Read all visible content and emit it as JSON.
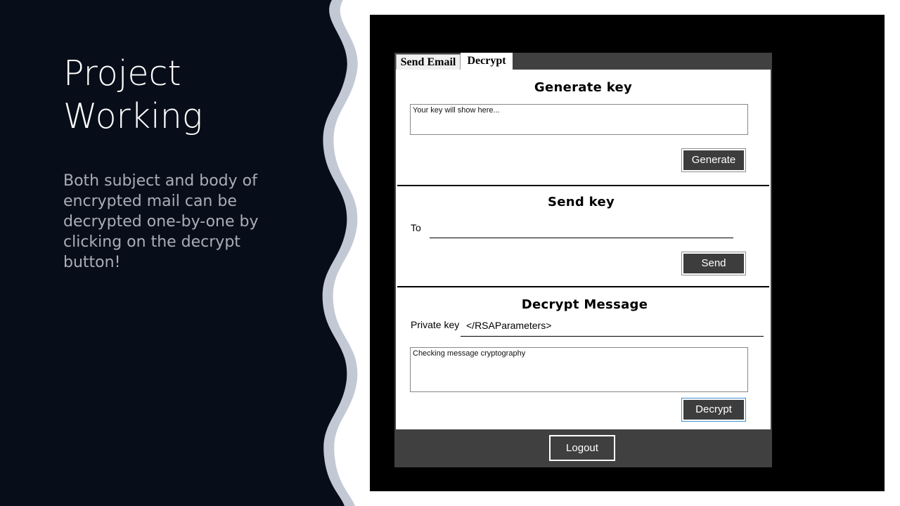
{
  "slide": {
    "title_line1": "Project",
    "title_line2": "Working",
    "body": "Both subject and body of encrypted mail can be decrypted one-by-one by clicking on the decrypt button!",
    "colors": {
      "background": "#080e19",
      "wave": "#c3c9d4",
      "title": "#ffffff",
      "body": "#a9adb6"
    }
  },
  "app": {
    "tabs": [
      {
        "label": "Send Email",
        "active": false
      },
      {
        "label": "Decrypt",
        "active": true
      }
    ],
    "generate_key": {
      "title": "Generate key",
      "key_box_placeholder": "Your key will show here...",
      "button": "Generate"
    },
    "send_key": {
      "title": "Send key",
      "to_label": "To",
      "to_value": "",
      "button": "Send"
    },
    "decrypt_message": {
      "title": "Decrypt Message",
      "private_key_label": "Private key",
      "private_key_value": "</RSAParameters>",
      "message_box_text": "Checking message cryptography",
      "button": "Decrypt"
    },
    "logout_button": "Logout",
    "colors": {
      "window": "#404040",
      "button": "#3d3d3d",
      "panel": "#ffffff"
    }
  }
}
